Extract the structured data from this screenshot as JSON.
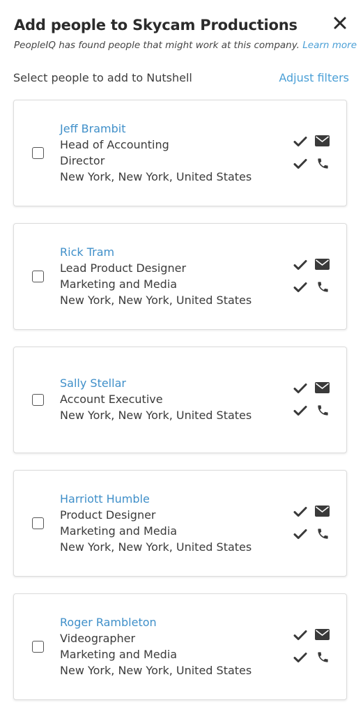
{
  "dialog": {
    "title": "Add people to Skycam Productions",
    "subtitle_text": "PeopleIQ has found people that might work at this company.",
    "learn_more": "Learn more",
    "close_icon": "close-icon"
  },
  "selection": {
    "prompt": "Select people to add to Nutshell",
    "adjust_filters": "Adjust filters"
  },
  "people": [
    {
      "name": "Jeff Brambit",
      "lines": [
        "Head of Accounting",
        "Director",
        "New York, New York, United States"
      ],
      "email_verified": true,
      "phone_verified": true,
      "selected": false
    },
    {
      "name": "Rick Tram",
      "lines": [
        "Lead Product Designer",
        "Marketing and Media",
        "New York, New York, United States"
      ],
      "email_verified": true,
      "phone_verified": true,
      "selected": false
    },
    {
      "name": "Sally Stellar",
      "lines": [
        "Account Executive",
        "New York, New York, United States"
      ],
      "email_verified": true,
      "phone_verified": true,
      "selected": false
    },
    {
      "name": "Harriott Humble",
      "lines": [
        "Product Designer",
        "Marketing and Media",
        "New York, New York, United States"
      ],
      "email_verified": true,
      "phone_verified": true,
      "selected": false
    },
    {
      "name": "Roger Rambleton",
      "lines": [
        "Videographer",
        "Marketing and Media",
        "New York, New York, United States"
      ],
      "email_verified": true,
      "phone_verified": true,
      "selected": false
    }
  ],
  "colors": {
    "link": "#4a9fd6",
    "name": "#3f8fc9",
    "text": "#3b3b3b",
    "icon": "#3a3a3a"
  }
}
